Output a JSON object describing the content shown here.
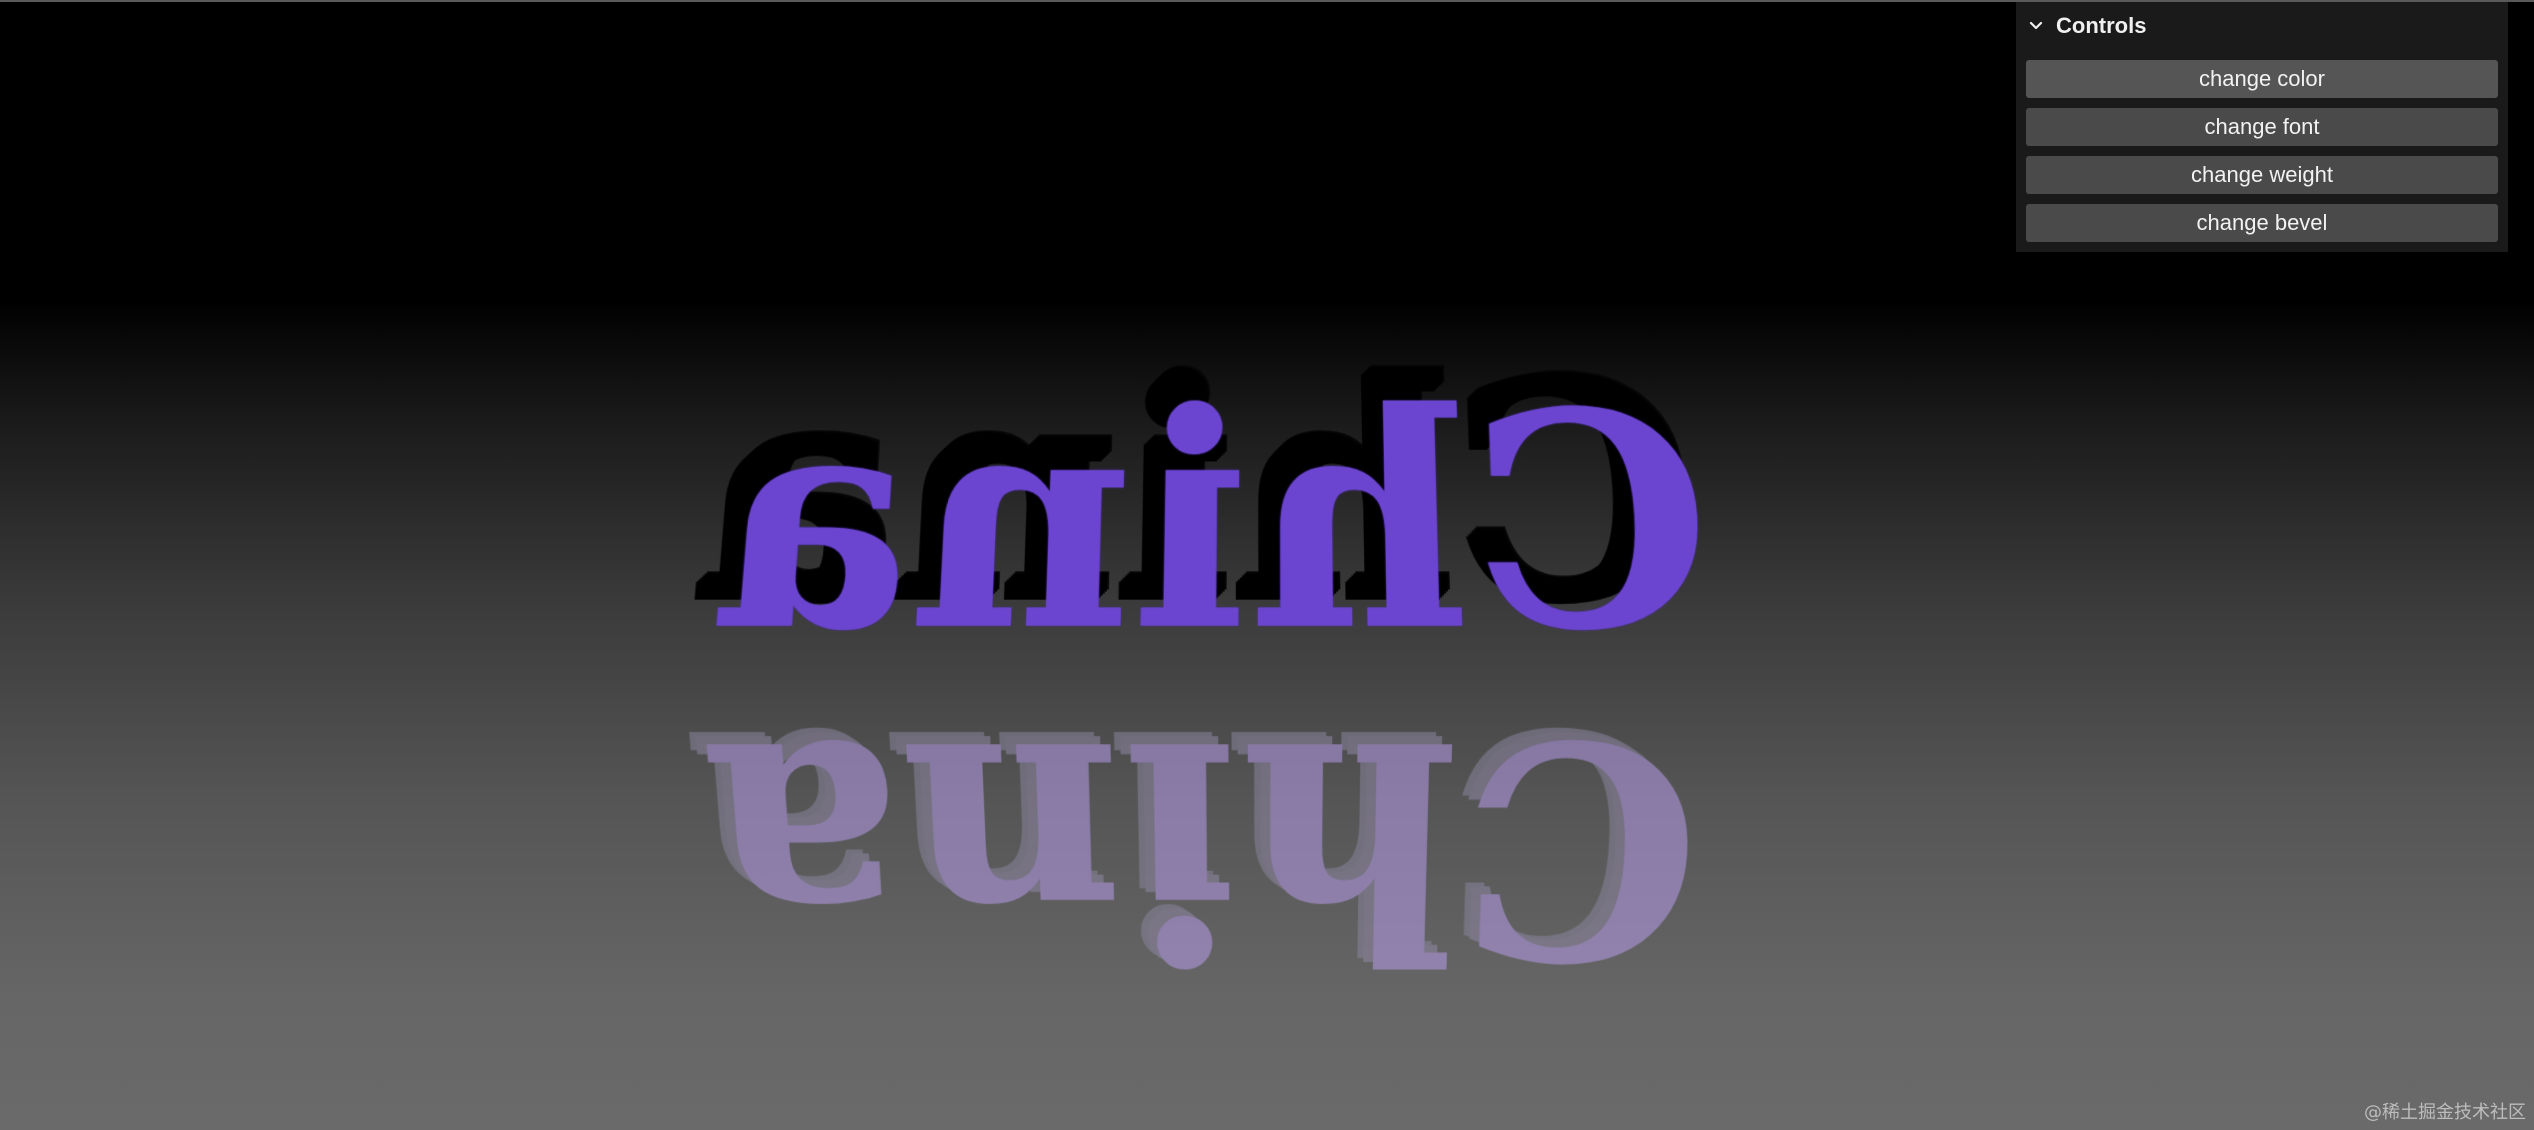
{
  "scene": {
    "text": "China",
    "text_color": "#6b45cf",
    "reflection_color": "#b49be8"
  },
  "controls": {
    "title": "Controls",
    "buttons": [
      {
        "label": "change color"
      },
      {
        "label": "change font"
      },
      {
        "label": "change weight"
      },
      {
        "label": "change bevel"
      }
    ]
  },
  "watermark": "@稀土掘金技术社区"
}
